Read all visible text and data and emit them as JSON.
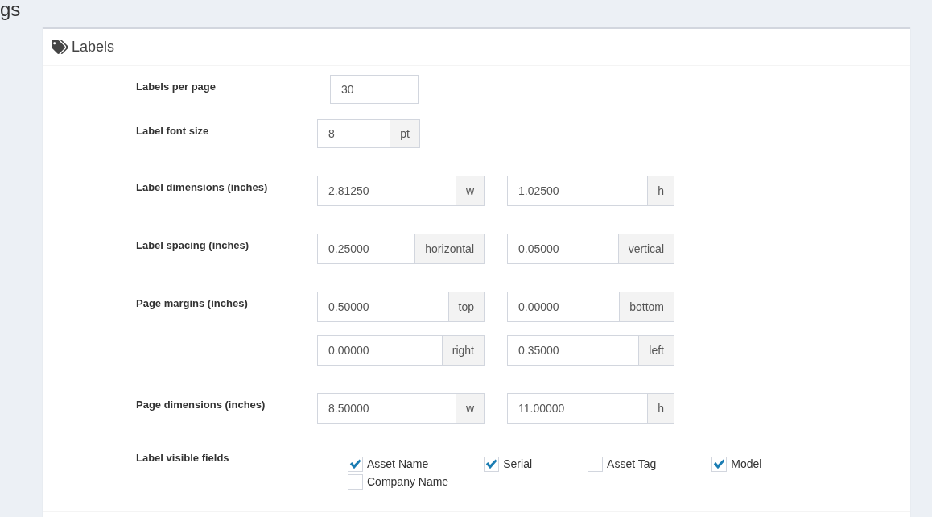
{
  "page_title": "gs",
  "panel": {
    "title": "Labels"
  },
  "settings": [
    {
      "label": "Labels per page",
      "fields": [
        {
          "value": "30"
        }
      ]
    },
    {
      "label": "Label font size",
      "fields": [
        {
          "value": "8",
          "addon": "pt"
        }
      ]
    },
    {
      "label": "Label dimensions (inches)",
      "fields": [
        {
          "value": "2.81250",
          "addon": "w"
        },
        {
          "value": "1.02500",
          "addon": "h"
        }
      ]
    },
    {
      "label": "Label spacing (inches)",
      "fields": [
        {
          "value": "0.25000",
          "addon": "horizontal"
        },
        {
          "value": "0.05000",
          "addon": "vertical"
        }
      ]
    },
    {
      "label": "Page margins (inches)",
      "fields": [
        {
          "value": "0.50000",
          "addon": "top"
        },
        {
          "value": "0.00000",
          "addon": "bottom"
        },
        {
          "value": "0.00000",
          "addon": "right"
        },
        {
          "value": "0.35000",
          "addon": "left"
        }
      ]
    },
    {
      "label": "Page dimensions (inches)",
      "fields": [
        {
          "value": "8.50000",
          "addon": "w"
        },
        {
          "value": "11.00000",
          "addon": "h"
        }
      ]
    }
  ],
  "visible_fields": {
    "label": "Label visible fields",
    "options": [
      {
        "label": "Asset Name",
        "checked": true
      },
      {
        "label": "Serial",
        "checked": true
      },
      {
        "label": "Asset Tag",
        "checked": false
      },
      {
        "label": "Model",
        "checked": true
      },
      {
        "label": "Company Name",
        "checked": false
      }
    ]
  }
}
